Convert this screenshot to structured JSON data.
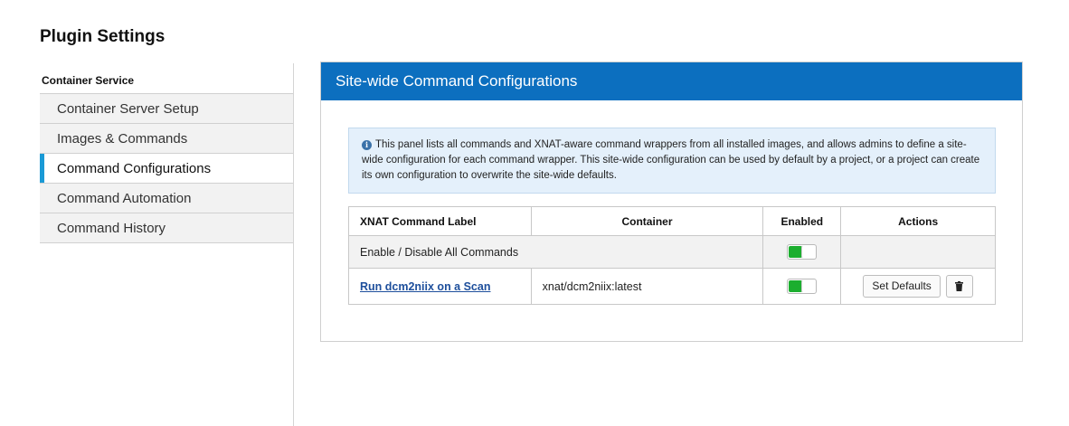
{
  "page": {
    "title": "Plugin Settings"
  },
  "sidebar": {
    "heading": "Container Service",
    "items": [
      {
        "label": "Container Server Setup",
        "active": false
      },
      {
        "label": "Images & Commands",
        "active": false
      },
      {
        "label": "Command Configurations",
        "active": true
      },
      {
        "label": "Command Automation",
        "active": false
      },
      {
        "label": "Command History",
        "active": false
      }
    ]
  },
  "panel": {
    "title": "Site-wide Command Configurations",
    "info_icon": "info-circle-icon",
    "info_text": "This panel lists all commands and XNAT-aware command wrappers from all installed images, and allows admins to define a site-wide configuration for each command wrapper. This site-wide configuration can be used by default by a project, or a project can create its own configuration to overwrite the site-wide defaults."
  },
  "table": {
    "headers": {
      "label": "XNAT Command Label",
      "container": "Container",
      "enabled": "Enabled",
      "actions": "Actions"
    },
    "toggle_all": {
      "label": "Enable / Disable All Commands",
      "enabled": true
    },
    "rows": [
      {
        "label": "Run dcm2niix on a Scan",
        "container": "xnat/dcm2niix:latest",
        "enabled": true,
        "set_defaults_label": "Set Defaults",
        "delete_icon": "trash-icon"
      }
    ]
  },
  "colors": {
    "header_blue": "#0c6fbf",
    "active_accent": "#1a9ad6",
    "toggle_on": "#1cae2f",
    "link": "#1e4f9c",
    "info_bg": "#e4f0fb"
  }
}
